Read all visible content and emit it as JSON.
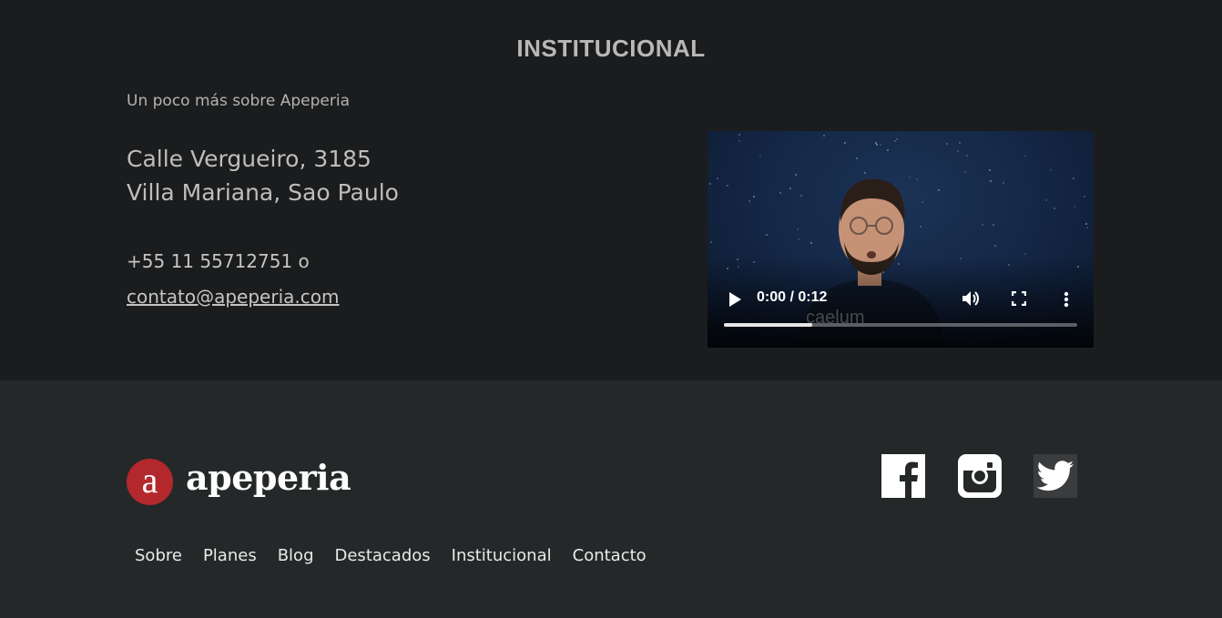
{
  "institucional": {
    "title": "INSTITUCIONAL",
    "subtitle": "Un poco más sobre Apeperia",
    "address_line1": "Calle Vergueiro, 3185",
    "address_line2": "Villa Mariana, Sao Paulo",
    "phone": "+55 11 55712751 o",
    "email": "contato@apeperia.com"
  },
  "video": {
    "time": "0:00 / 0:12",
    "watermark": "caelum",
    "progress": 0.25,
    "icons": [
      "play-icon",
      "volume-icon",
      "fullscreen-icon",
      "more-vert-icon"
    ]
  },
  "footer": {
    "logo_letter": "a",
    "logo_text": "apeperia",
    "brand_color": "#b3282d",
    "social": [
      "facebook-icon",
      "instagram-icon",
      "twitter-icon"
    ],
    "nav": [
      "Sobre",
      "Planes",
      "Blog",
      "Destacados",
      "Institucional",
      "Contacto"
    ]
  }
}
